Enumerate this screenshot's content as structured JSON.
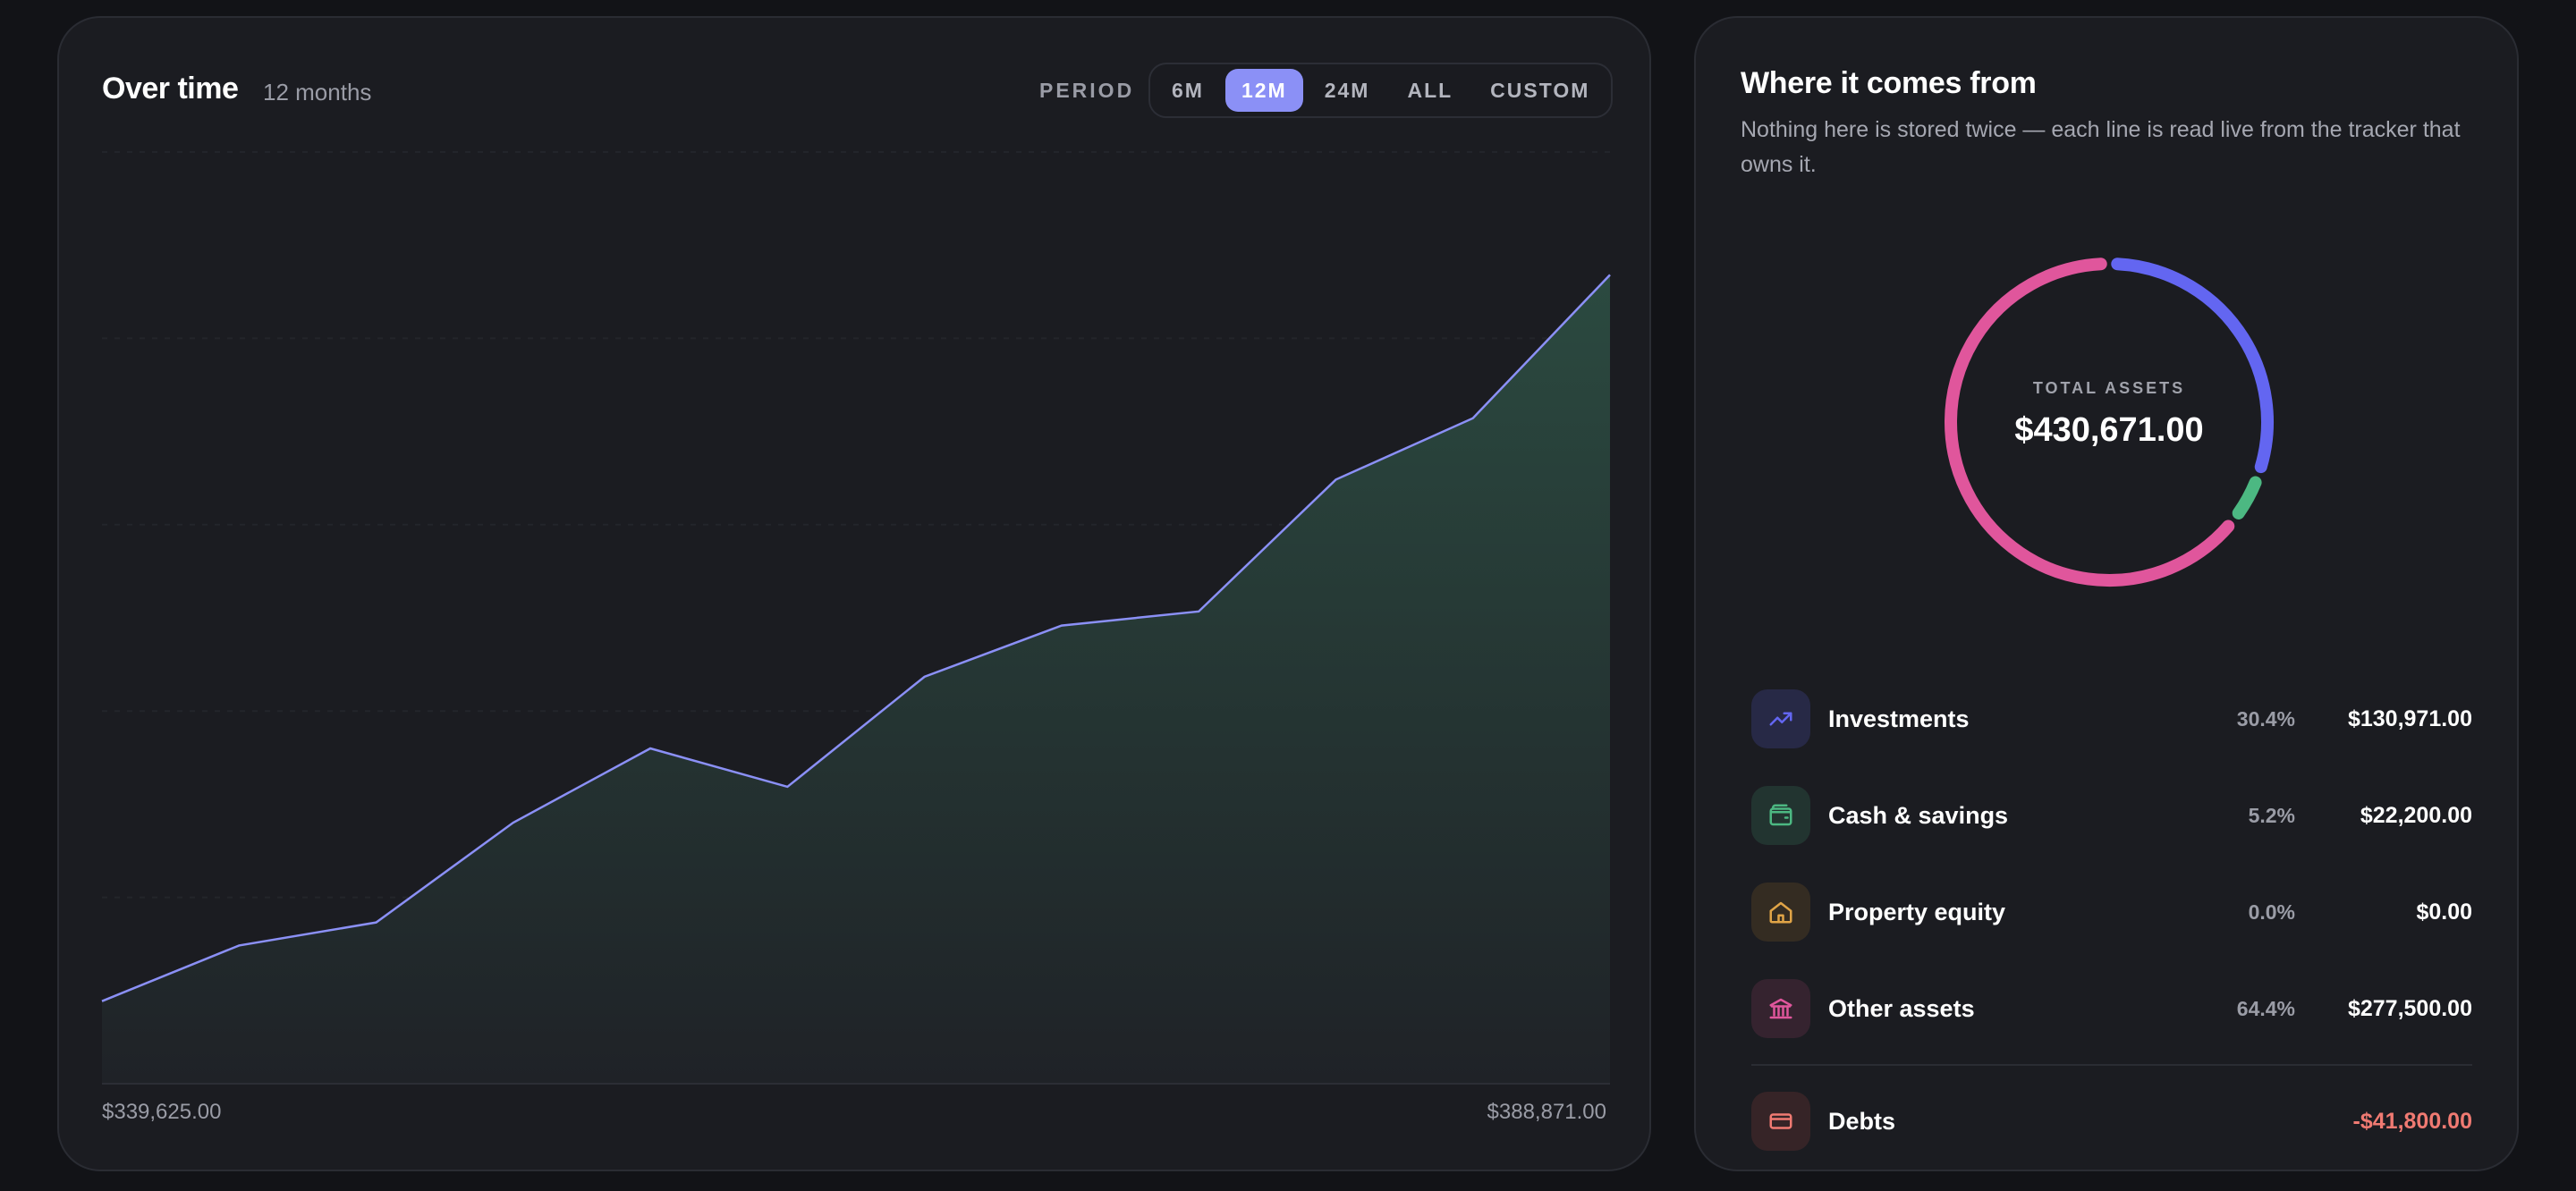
{
  "over_time": {
    "title": "Over time",
    "subtitle": "12 months",
    "period_label": "PERIOD",
    "periods": [
      "6M",
      "12M",
      "24M",
      "ALL",
      "CUSTOM"
    ],
    "active_period": "12M",
    "axis_min_label": "$339,625.00",
    "axis_max_label": "$388,871.00"
  },
  "chart_data": {
    "type": "area",
    "values": [
      339625,
      341800,
      342700,
      346600,
      349500,
      348000,
      352300,
      354300,
      354850,
      360000,
      362400,
      368000
    ],
    "ylim": [
      336400,
      372800
    ],
    "colors": {
      "line": "#8b90f6",
      "fill_top": "#2b4a40",
      "fill_bottom": "#1f2227"
    }
  },
  "sources": {
    "title": "Where it comes from",
    "description": "Nothing here is stored twice — each line is read live from the tracker that owns it.",
    "donut": {
      "label": "TOTAL ASSETS",
      "value": "$430,671.00",
      "segments": [
        {
          "name": "Investments",
          "fraction": 0.304,
          "color": "#6366f1"
        },
        {
          "name": "Cash & savings",
          "fraction": 0.052,
          "color": "#4cb882"
        },
        {
          "name": "Property equity",
          "fraction": 0.0,
          "color": "#e0a447"
        },
        {
          "name": "Other assets",
          "fraction": 0.644,
          "color": "#e0569c"
        }
      ]
    },
    "rows": [
      {
        "name": "Investments",
        "pct": "30.4%",
        "amount": "$130,971.00",
        "icon": "trending-up-icon",
        "color": "#6366f1",
        "bg": "#272946"
      },
      {
        "name": "Cash & savings",
        "pct": "5.2%",
        "amount": "$22,200.00",
        "icon": "wallet-icon",
        "color": "#4cb882",
        "bg": "#223430"
      },
      {
        "name": "Property equity",
        "pct": "0.0%",
        "amount": "$0.00",
        "icon": "home-icon",
        "color": "#e0a447",
        "bg": "#342c22"
      },
      {
        "name": "Other assets",
        "pct": "64.4%",
        "amount": "$277,500.00",
        "icon": "bank-icon",
        "color": "#e0569c",
        "bg": "#35232f"
      }
    ],
    "debts": {
      "name": "Debts",
      "amount": "-$41,800.00",
      "icon": "credit-card-icon",
      "color": "#f07a72",
      "bg": "#362427"
    }
  }
}
